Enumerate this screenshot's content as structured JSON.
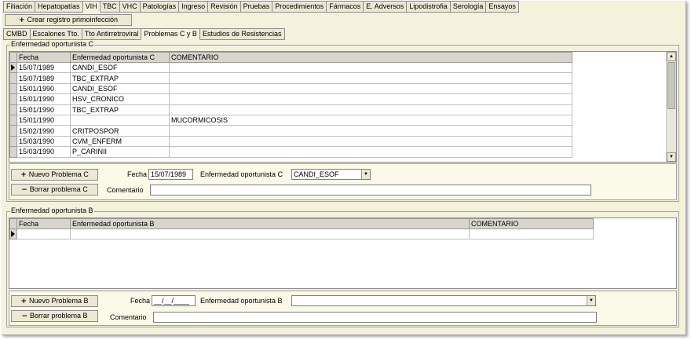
{
  "top_tabs": [
    {
      "label": "Filiación",
      "name": "tab-filiacion"
    },
    {
      "label": "Hepatopatías",
      "name": "tab-hepatopatias"
    },
    {
      "label": "VIH",
      "name": "tab-vih",
      "active": true
    },
    {
      "label": "TBC",
      "name": "tab-tbc"
    },
    {
      "label": "VHC",
      "name": "tab-vhc"
    },
    {
      "label": "Patologías",
      "name": "tab-patologias"
    },
    {
      "label": "Ingreso",
      "name": "tab-ingreso"
    },
    {
      "label": "Revisión",
      "name": "tab-revision"
    },
    {
      "label": "Pruebas",
      "name": "tab-pruebas"
    },
    {
      "label": "Procedimientos",
      "name": "tab-procedimientos"
    },
    {
      "label": "Fármacos",
      "name": "tab-farmacos"
    },
    {
      "label": "E. Adversos",
      "name": "tab-e-adversos"
    },
    {
      "label": "Lipodistrofia",
      "name": "tab-lipodistrofia"
    },
    {
      "label": "Serología",
      "name": "tab-serologia"
    },
    {
      "label": "Ensayos",
      "name": "tab-ensayos"
    }
  ],
  "create_button": {
    "icon": "plus-icon",
    "label": "Crear registro primoinfección"
  },
  "sub_tabs": [
    {
      "label": "CMBD",
      "name": "subtab-cmbd"
    },
    {
      "label": "Escalones Tto.",
      "name": "subtab-escalones"
    },
    {
      "label": "Tto Antirretroviral",
      "name": "subtab-tto-antirretroviral"
    },
    {
      "label": "Problemas C y B",
      "name": "subtab-problemas",
      "active": true
    },
    {
      "label": "Estudios de Resistencias",
      "name": "subtab-estudios"
    }
  ],
  "section_c": {
    "title": "Enfermedad oportunista C",
    "columns": [
      "Fecha",
      "Enfermedad oportunista C",
      "COMENTARIO"
    ],
    "rows": [
      [
        "15/07/1989",
        "CANDI_ESOF",
        ""
      ],
      [
        "15/07/1989",
        "TBC_EXTRAP",
        ""
      ],
      [
        "15/01/1990",
        "CANDI_ESOF",
        ""
      ],
      [
        "15/01/1990",
        "HSV_CRONICO",
        ""
      ],
      [
        "15/01/1990",
        "TBC_EXTRAP",
        ""
      ],
      [
        "15/01/1990",
        "",
        "MUCORMICOSIS"
      ],
      [
        "15/02/1990",
        "CRITPOSPOR",
        ""
      ],
      [
        "15/03/1990",
        "CVM_ENFERM",
        ""
      ],
      [
        "15/03/1990",
        "P_CARINII",
        ""
      ]
    ],
    "new_button": "Nuevo Problema C",
    "delete_button": "Borrar problema C",
    "fecha_label": "Fecha",
    "fecha_value": "15/07/1989",
    "enfermedad_label": "Enfermedad oportunista C",
    "enfermedad_value": "CANDI_ESOF",
    "comentario_label": "Comentario",
    "comentario_value": ""
  },
  "section_b": {
    "title": "Enfermedad oportunista B",
    "columns": [
      "Fecha",
      "Enfermedad oportunista B",
      "COMENTARIO"
    ],
    "rows": [
      [
        "",
        "",
        ""
      ]
    ],
    "new_button": "Nuevo Problema B",
    "delete_button": "Borrar problema B",
    "fecha_label": "Fecha",
    "fecha_value": "__/__/____",
    "enfermedad_label": "Enfermedad oportunista B",
    "enfermedad_value": "",
    "comentario_label": "Comentario",
    "comentario_value": ""
  }
}
